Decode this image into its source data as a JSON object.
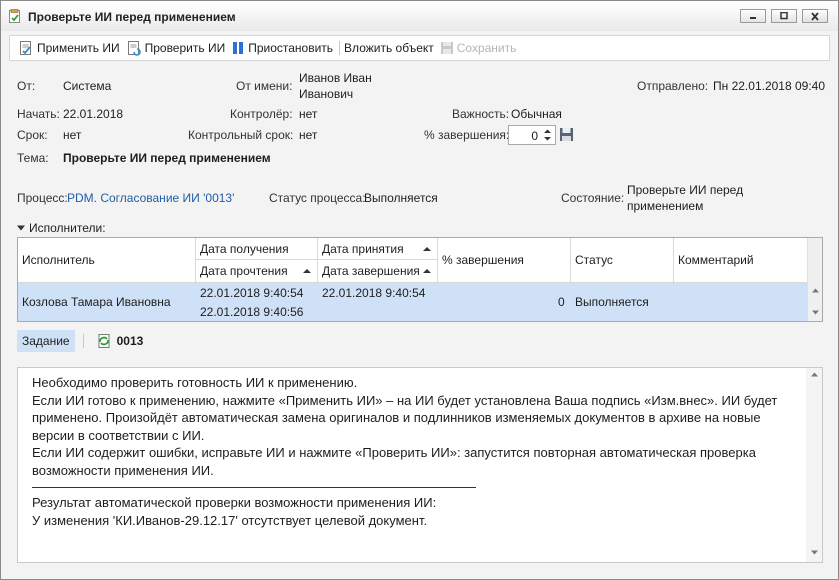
{
  "window": {
    "title": "Проверьте ИИ перед применением"
  },
  "toolbar": {
    "apply": "Применить ИИ",
    "check": "Проверить ИИ",
    "pause": "Приостановить",
    "attach": "Вложить объект",
    "save": "Сохранить"
  },
  "header": {
    "from_label": "От:",
    "from_value": "Система",
    "on_behalf_label": "От имени:",
    "on_behalf_value_1": "Иванов Иван",
    "on_behalf_value_2": "Иванович",
    "sent_label": "Отправлено:",
    "sent_value": "Пн 22.01.2018 09:40",
    "start_label": "Начать:",
    "start_value": "22.01.2018",
    "controller_label": "Контролёр:",
    "controller_value": "нет",
    "importance_label": "Важность:",
    "importance_value": "Обычная",
    "due_label": "Срок:",
    "due_value": "нет",
    "control_due_label": "Контрольный срок:",
    "control_due_value": "нет",
    "completion_label": "% завершения:",
    "completion_value": "0",
    "subject_label": "Тема:",
    "subject_value": "Проверьте ИИ перед применением"
  },
  "process": {
    "label": "Процесс:",
    "value": "PDM. Согласование ИИ '0013'",
    "status_label": "Статус процесса:",
    "status_value": "Выполняется",
    "state_label": "Состояние:",
    "state_value_1": "Проверьте ИИ перед",
    "state_value_2": "применением"
  },
  "executors": {
    "section_label": "Исполнители:",
    "columns": {
      "executor": "Исполнитель",
      "received": "Дата получения",
      "read": "Дата прочтения",
      "accepted": "Дата принятия",
      "finished": "Дата завершения",
      "percent": "% завершения",
      "status": "Статус",
      "comment": "Комментарий"
    },
    "rows": [
      {
        "executor": "Козлова Тамара Ивановна",
        "received": "22.01.2018 9:40:54",
        "read": "22.01.2018 9:40:56",
        "accepted": "22.01.2018 9:40:54",
        "finished": "",
        "percent": "0",
        "status": "Выполняется",
        "comment": ""
      }
    ]
  },
  "tabs": {
    "task": "Задание",
    "document": "0013"
  },
  "body_text": {
    "line1": "Необходимо проверить готовность ИИ к применению.",
    "line2": "Если ИИ готово к применению, нажмите «Применить ИИ» – на ИИ будет установлена Ваша подпись «Изм.внес». ИИ будет",
    "line3": "применено. Произойдёт автоматическая замена оригиналов и подлинников изменяемых документов в архиве на новые",
    "line4": "версии в соответствии с ИИ.",
    "line5": "Если ИИ содержит ошибки, исправьте ИИ и нажмите «Проверить ИИ»: запустится повторная автоматическая проверка",
    "line6": "возможности применения ИИ.",
    "line7": "Результат автоматической проверки возможности применения ИИ:",
    "line8": "У изменения 'КИ.Иванов-29.12.17' отсутствует целевой документ."
  }
}
